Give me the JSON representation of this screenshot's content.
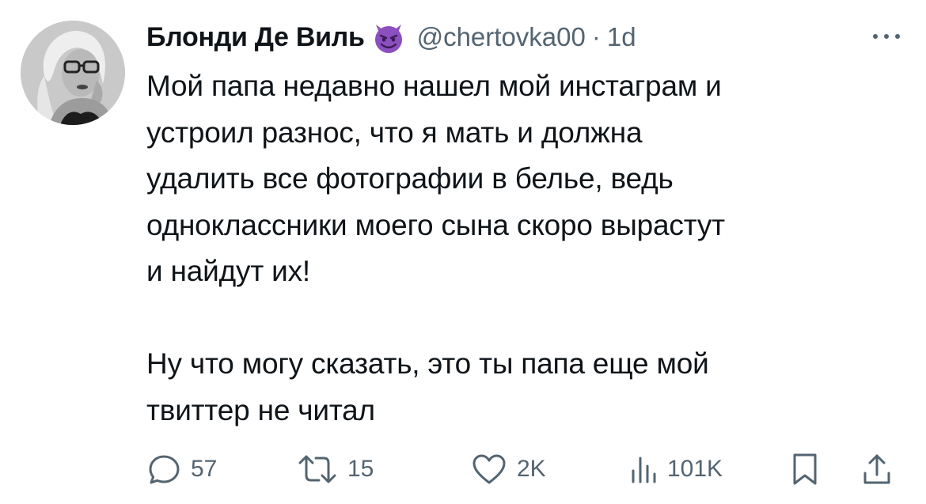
{
  "tweet": {
    "author": {
      "display_name": "Блонди Де Виль",
      "name_emoji": "smiling-devil-emoji",
      "handle": "@chertovka00",
      "separator": "·",
      "time": "1d"
    },
    "text_line_1": "Мой папа недавно нашел мой инстаграм и\nустроил разнос, что я мать и должна\nудалить все фотографии в белье, ведь\nодноклассники моего сына скоро вырастут\nи найдут их!",
    "text_line_2": "Ну что могу сказать, это ты папа еще мой\nтвиттер не читал",
    "actions": {
      "replies": "57",
      "retweets": "15",
      "likes": "2K",
      "views": "101K"
    },
    "icons": {
      "reply": "reply-icon",
      "retweet": "retweet-icon",
      "like": "heart-icon",
      "views": "views-chart-icon",
      "bookmark": "bookmark-icon",
      "share": "share-icon",
      "more": "more-dots-icon"
    },
    "colors": {
      "text": "#0f1419",
      "secondary": "#536471",
      "emoji_purple": "#8c4fbf"
    }
  }
}
